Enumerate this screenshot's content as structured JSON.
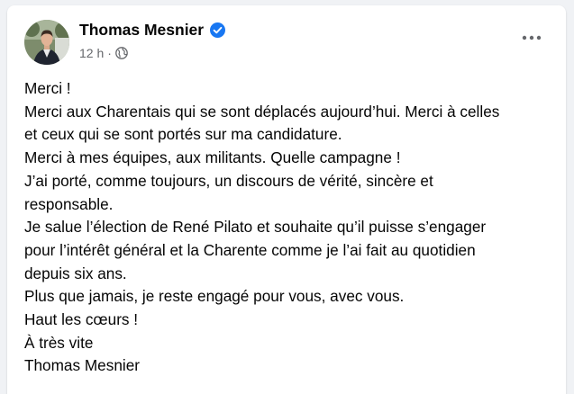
{
  "post": {
    "author": "Thomas Mesnier",
    "timestamp": "12 h",
    "separator": "·",
    "privacy_icon": "globe-icon",
    "verified_icon": "verified-badge-icon",
    "more_icon": "more-options-icon",
    "lines": [
      "Merci !",
      "Merci aux Charentais qui se sont déplacés aujourd’hui. Merci à celles",
      "et ceux qui se sont portés sur ma candidature.",
      "Merci à mes équipes, aux militants. Quelle campagne !",
      "J’ai porté, comme toujours, un discours de vérité, sincère et",
      "responsable.",
      "Je salue l’élection de René Pilato et souhaite qu’il puisse s’engager",
      "pour l’intérêt général et la Charente comme je l’ai fait au quotidien",
      "depuis six ans.",
      "Plus que jamais, je reste engagé pour vous, avec vous.",
      "Haut les cœurs !",
      "À très vite",
      "Thomas Mesnier"
    ]
  },
  "colors": {
    "background": "#f0f2f5",
    "card": "#ffffff",
    "text": "#050505",
    "secondary_text": "#65676b",
    "verified": "#1877f2"
  }
}
